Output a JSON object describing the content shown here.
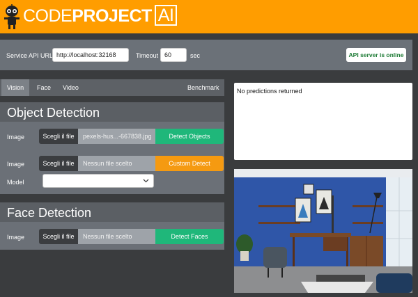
{
  "header": {
    "brand_light": "CODE",
    "brand_bold": "PROJECT",
    "brand_ai": "AI"
  },
  "service": {
    "api_url_label": "Service API URL",
    "api_url_value": "http://localhost:32168",
    "timeout_label": "Timeout",
    "timeout_value": "60",
    "timeout_unit": "sec",
    "status": "API server is online"
  },
  "tabs": [
    {
      "label": "Vision",
      "active": true
    },
    {
      "label": "Face",
      "active": false
    },
    {
      "label": "Video",
      "active": false
    },
    {
      "label": "Benchmark",
      "active": false
    }
  ],
  "object_detection": {
    "title": "Object Detection",
    "image_label_1": "Image",
    "choose_file_1": "Scegli il file",
    "file_name_1": "pexels-hus...-667838.jpg",
    "detect_objects": "Detect Objects",
    "image_label_2": "Image",
    "choose_file_2": "Scegli il file",
    "file_name_2": "Nessun file scelto",
    "custom_detect": "Custom Detect",
    "model_label": "Model",
    "model_value": ""
  },
  "face_detection": {
    "title": "Face Detection",
    "image_label": "Image",
    "choose_file": "Scegli il file",
    "file_name": "Nessun file scelto",
    "detect_faces": "Detect Faces"
  },
  "results": {
    "text": "No predictions returned"
  },
  "colors": {
    "header": "#ff9d00",
    "page_bg": "#3a3c3e",
    "green_button": "#1fb77a",
    "orange_button": "#f59a11",
    "status_text": "#1c7a34"
  }
}
